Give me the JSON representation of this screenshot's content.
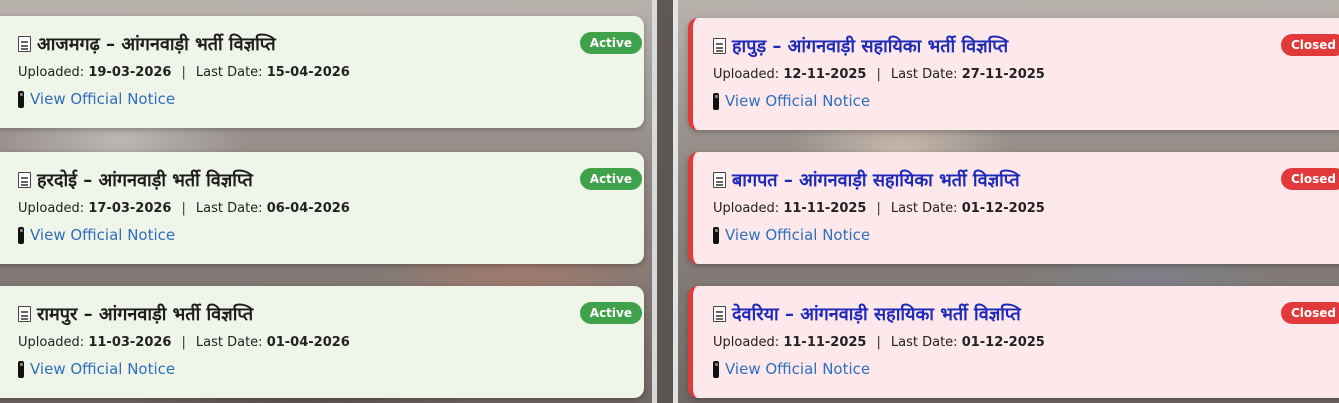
{
  "left_cards": [
    {
      "title": "आजमगढ़ – आंगनवाड़ी भर्ती विज्ञप्ति",
      "uploaded_label": "Uploaded:",
      "uploaded": "19-03-2026",
      "last_label": "Last Date:",
      "last_date": "15-04-2026",
      "link": "View Official Notice",
      "status": "Active"
    },
    {
      "title": "हरदोई – आंगनवाड़ी भर्ती विज्ञप्ति",
      "uploaded_label": "Uploaded:",
      "uploaded": "17-03-2026",
      "last_label": "Last Date:",
      "last_date": "06-04-2026",
      "link": "View Official Notice",
      "status": "Active"
    },
    {
      "title": "रामपुर – आंगनवाड़ी भर्ती विज्ञप्ति",
      "uploaded_label": "Uploaded:",
      "uploaded": "11-03-2026",
      "last_label": "Last Date:",
      "last_date": "01-04-2026",
      "link": "View Official Notice",
      "status": "Active"
    }
  ],
  "right_cards": [
    {
      "title": "हापुड़ – आंगनवाड़ी सहायिका भर्ती विज्ञप्ति",
      "uploaded_label": "Uploaded:",
      "uploaded": "12-11-2025",
      "last_label": "Last Date:",
      "last_date": "27-11-2025",
      "link": "View Official Notice",
      "status": "Closed"
    },
    {
      "title": "बागपत – आंगनवाड़ी सहायिका भर्ती विज्ञप्ति",
      "uploaded_label": "Uploaded:",
      "uploaded": "11-11-2025",
      "last_label": "Last Date:",
      "last_date": "01-12-2025",
      "link": "View Official Notice",
      "status": "Closed"
    },
    {
      "title": "देवरिया – आंगनवाड़ी सहायिका भर्ती विज्ञप्ति",
      "uploaded_label": "Uploaded:",
      "uploaded": "11-11-2025",
      "last_label": "Last Date:",
      "last_date": "01-12-2025",
      "link": "View Official Notice",
      "status": "Closed"
    }
  ],
  "separator": "|",
  "colors": {
    "active": "#3fa24a",
    "closed": "#e23a3a",
    "link": "#2f6fbd",
    "closed_title": "#1f2ab8"
  }
}
